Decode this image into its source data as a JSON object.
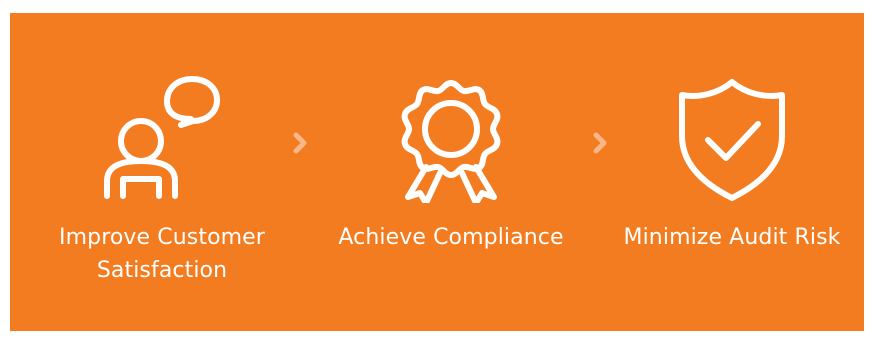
{
  "banner": {
    "background_color": "#f47c20",
    "icon_color": "#ffffff",
    "chevron_color": "#f8b689"
  },
  "steps": [
    {
      "icon": "customer-speech-bubble-icon",
      "label": "Improve Customer Satisfaction"
    },
    {
      "icon": "award-ribbon-icon",
      "label": "Achieve Compliance"
    },
    {
      "icon": "shield-check-icon",
      "label": "Minimize Audit Risk"
    }
  ],
  "separators": [
    {
      "icon": "chevron-right-icon"
    },
    {
      "icon": "chevron-right-icon"
    }
  ]
}
